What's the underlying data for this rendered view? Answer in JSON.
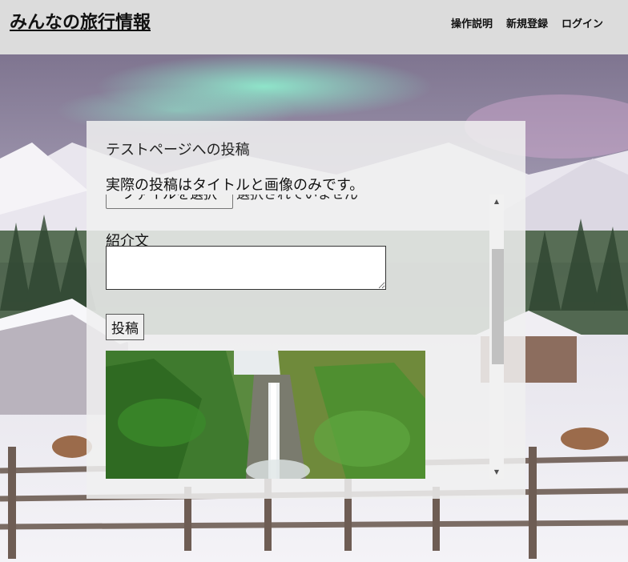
{
  "header": {
    "site_title": "みんなの旅行情報",
    "nav": [
      {
        "label": "操作説明"
      },
      {
        "label": "新規登録"
      },
      {
        "label": "ログイン"
      }
    ]
  },
  "panel": {
    "title": "テストページへの投稿",
    "notice": "実際の投稿はタイトルと画像のみです。",
    "file_button_label": "ファイルを選択",
    "file_status": "選択されていません",
    "intro_label": "紹介文",
    "intro_value": "",
    "submit_label": "投稿"
  },
  "scrollbar": {
    "up_arrow": "▲",
    "down_arrow": "▼"
  }
}
